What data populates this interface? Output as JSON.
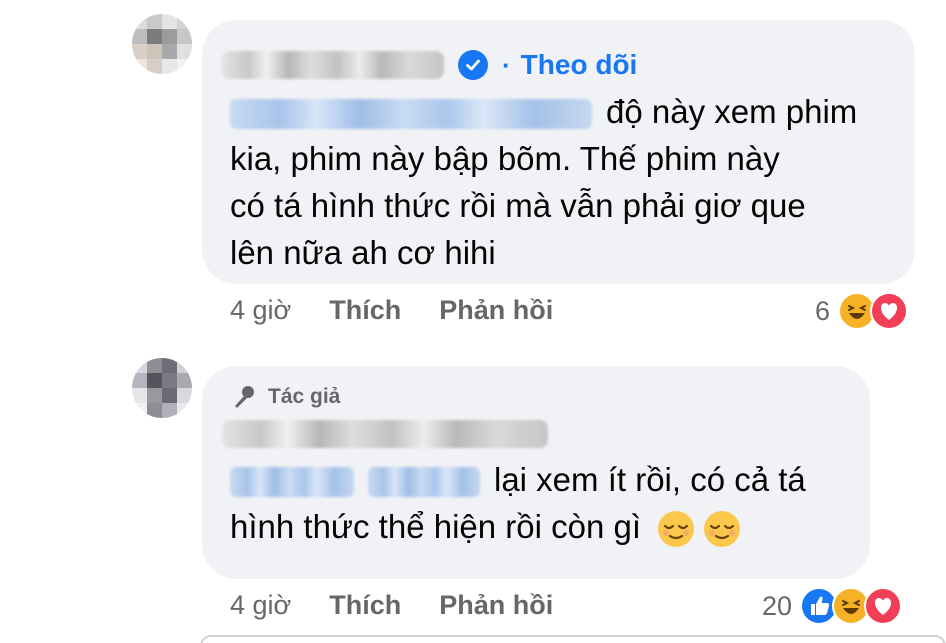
{
  "comments": [
    {
      "follow_label": "Theo dõi",
      "text": "độ này xem phim kia, phim này bập bõm. Thế phim này có tá hình thức rồi mà vẫn phải giơ que lên nữa ah cơ hihi",
      "text_lines": [
        "độ này xem phim",
        "kia, phim này bập bõm. Thế phim này",
        "có tá hình thức rồi mà vẫn phải giơ que",
        "lên nữa ah cơ hihi"
      ],
      "time": "4 giờ",
      "like_label": "Thích",
      "reply_label": "Phản hồi",
      "reaction_count": "6",
      "reactions": [
        "haha-icon",
        "love-icon"
      ]
    },
    {
      "author_badge": "Tác giả",
      "text_lines": [
        "lại xem ít rồi, có cả tá",
        "hình thức thể hiện rồi còn gì"
      ],
      "time": "4 giờ",
      "like_label": "Thích",
      "reply_label": "Phản hồi",
      "reaction_count": "20",
      "reactions": [
        "like-icon",
        "haha-icon",
        "love-icon"
      ],
      "emojis": [
        "relieved-face-emoji",
        "relieved-face-emoji"
      ]
    }
  ],
  "colors": {
    "bubble_bg": "#f0f2f5",
    "link_blue": "#1877f2",
    "meta_gray": "#65676b",
    "text": "#050505"
  }
}
